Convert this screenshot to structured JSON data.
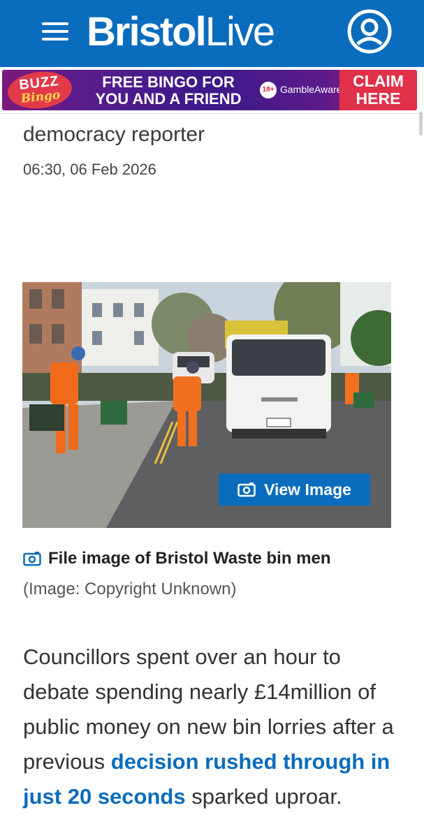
{
  "header": {
    "logo_bold": "Bristol",
    "logo_light": "Live",
    "menu_icon": "hamburger-menu-icon",
    "account_icon": "user-account-icon",
    "brand_color": "#0a6cbc"
  },
  "ad": {
    "logo_line1": "BUZZ",
    "logo_line2": "Bingo",
    "headline_line1": "FREE BINGO FOR",
    "headline_line2": "YOU AND A FRIEND",
    "age_badge": "18+",
    "gamble_aware": "GambleAware",
    "cta_line1": "CLAIM",
    "cta_line2": "HERE"
  },
  "article": {
    "byline_fragment": "democracy reporter",
    "date": "06:30, 06 Feb 2026",
    "image": {
      "view_button": "View Image",
      "camera_icon": "camera-icon",
      "caption": "File image of Bristol Waste bin men",
      "credit": "(Image: Copyright Unknown)"
    },
    "body": {
      "text_before_link": "Councillors spent over an hour to debate spending nearly £14million of public money on new bin lorries after a previous ",
      "link_text": "decision rushed through in just 20 seconds",
      "text_after_link": " sparked uproar."
    }
  }
}
